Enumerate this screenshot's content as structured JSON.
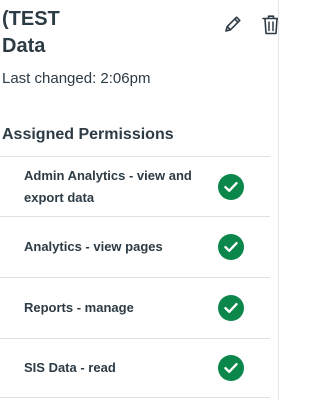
{
  "header": {
    "title_line1": "(TEST)",
    "title_line2": "Data",
    "last_changed": "Last changed: 2:06pm"
  },
  "actions": {
    "edit_icon": "pencil-icon",
    "delete_icon": "trash-icon"
  },
  "permissions": {
    "section_title": "Assigned Permissions",
    "items": [
      {
        "label": "Admin Analytics - view and export data",
        "status": "enabled"
      },
      {
        "label": "Analytics - view pages",
        "status": "enabled"
      },
      {
        "label": "Reports - manage",
        "status": "enabled"
      },
      {
        "label": "SIS Data - read",
        "status": "enabled"
      }
    ]
  },
  "colors": {
    "text": "#2d3b45",
    "check_green": "#0b874b",
    "divider": "#dfe2e5"
  }
}
